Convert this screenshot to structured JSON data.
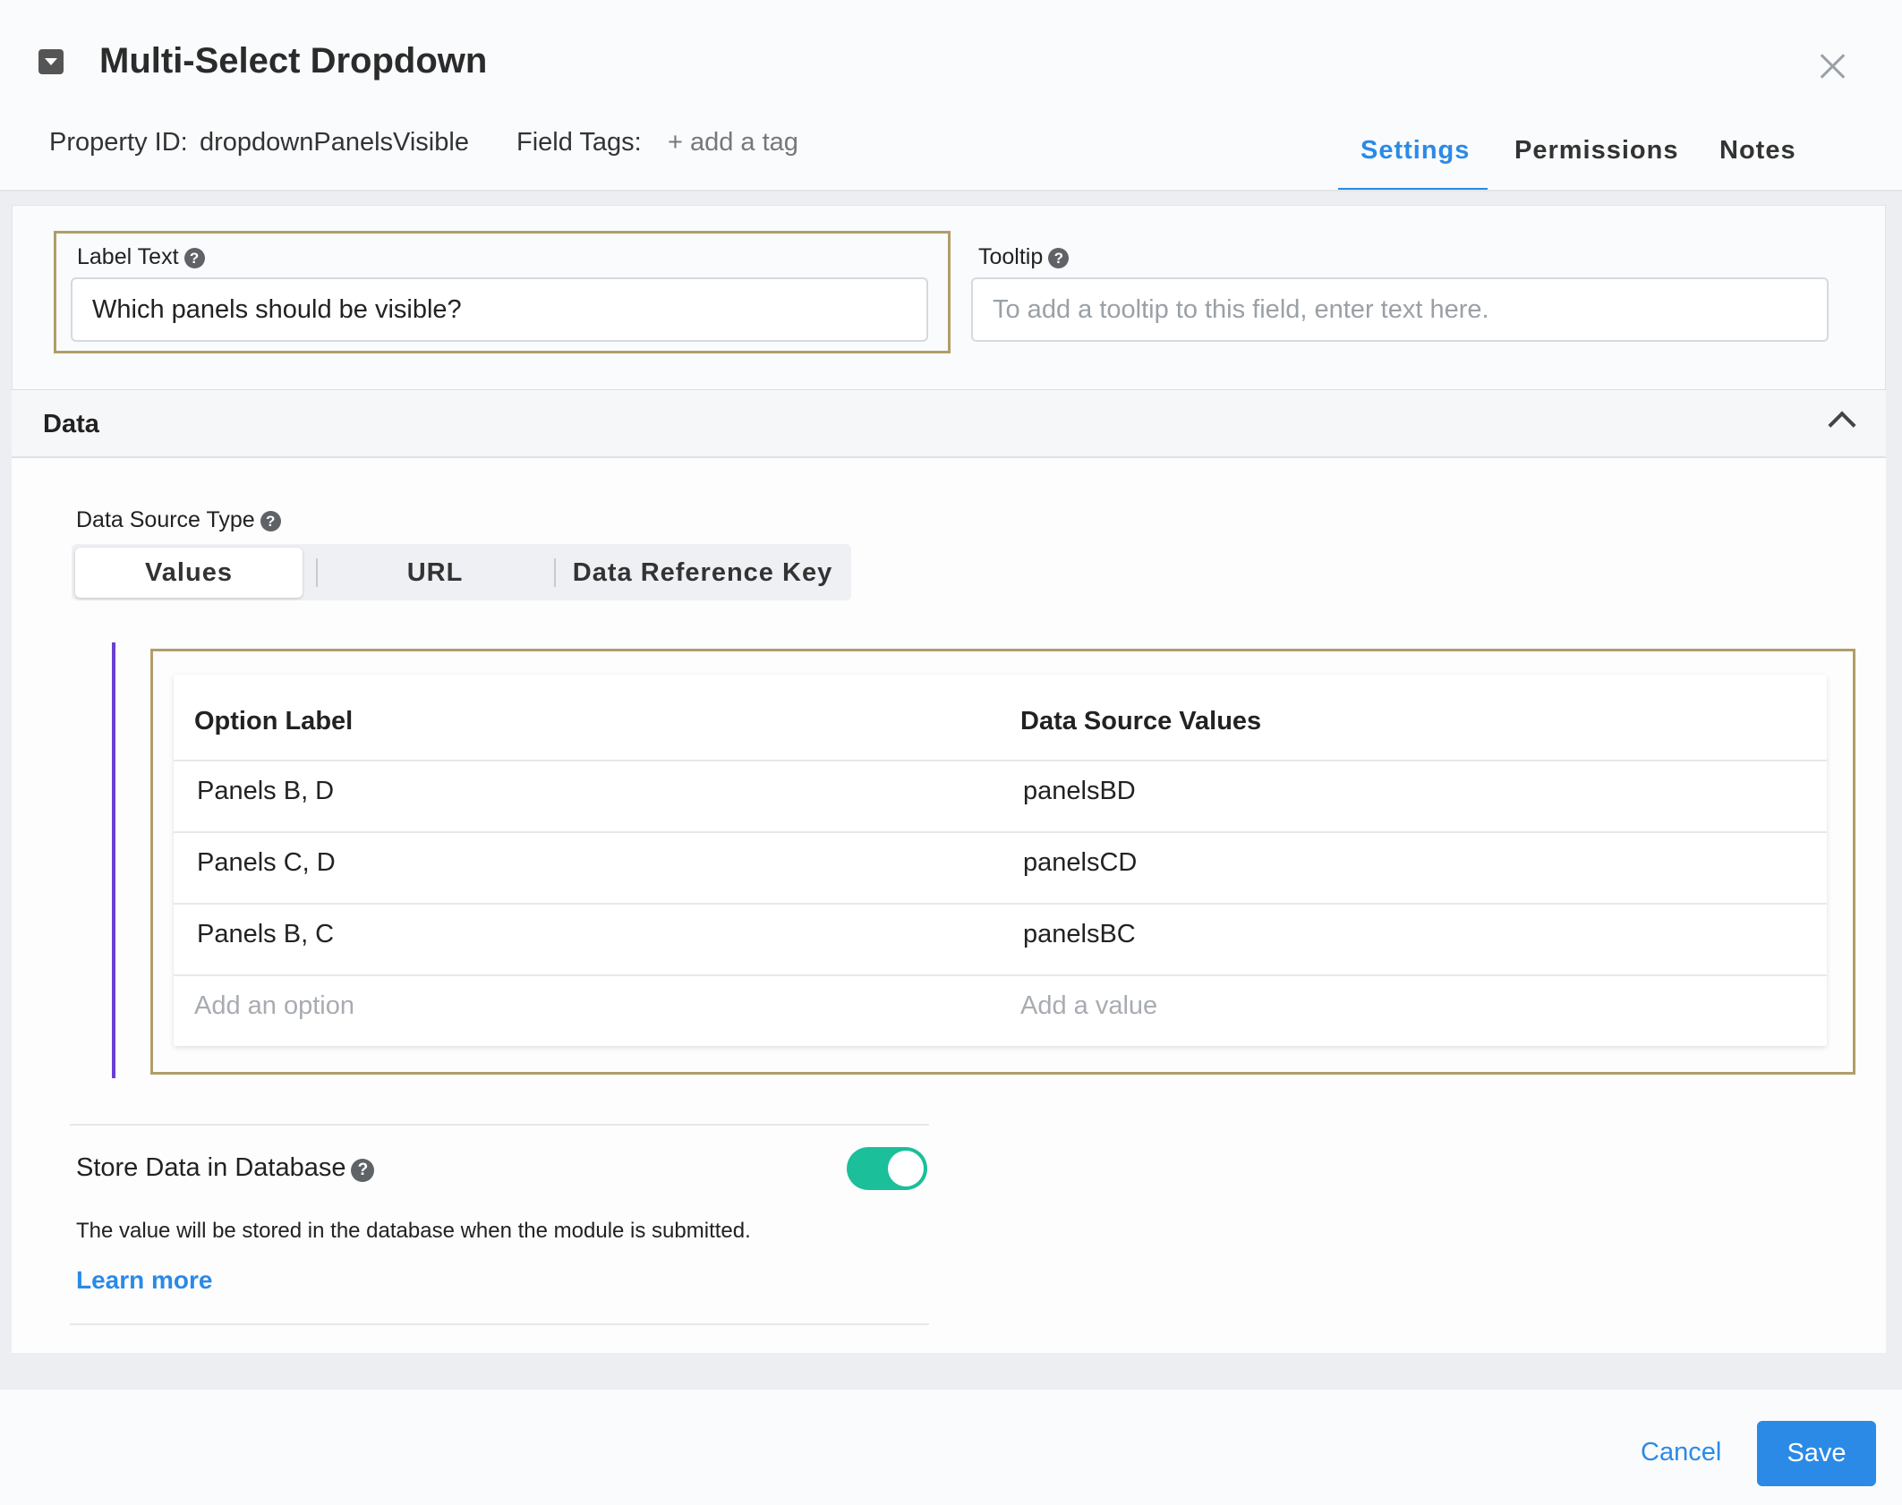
{
  "header": {
    "title": "Multi-Select Dropdown",
    "property_id_label": "Property ID:",
    "property_id_value": "dropdownPanelsVisible",
    "field_tags_label": "Field Tags:",
    "add_tag": "+ add a tag",
    "tabs": [
      {
        "label": "Settings",
        "active": true
      },
      {
        "label": "Permissions",
        "active": false
      },
      {
        "label": "Notes",
        "active": false
      }
    ]
  },
  "settings": {
    "label_text": {
      "label": "Label Text",
      "value": "Which panels should be visible?"
    },
    "tooltip": {
      "label": "Tooltip",
      "placeholder": "To add a tooltip to this field, enter text here."
    }
  },
  "data_section": {
    "title": "Data",
    "data_source_type_label": "Data Source Type",
    "segments": [
      {
        "label": "Values",
        "active": true
      },
      {
        "label": "URL",
        "active": false
      },
      {
        "label": "Data Reference Key",
        "active": false
      }
    ],
    "table": {
      "headers": [
        "Option Label",
        "Data Source Values"
      ],
      "rows": [
        [
          "Panels B, D",
          "panelsBD"
        ],
        [
          "Panels C, D",
          "panelsCD"
        ],
        [
          "Panels B, C",
          "panelsBC"
        ]
      ],
      "add_option_placeholder": "Add an option",
      "add_value_placeholder": "Add a value"
    },
    "store": {
      "label": "Store Data in Database",
      "enabled": true,
      "description": "The value will be stored in the database when the module is submitted.",
      "learn_more": "Learn more"
    }
  },
  "footer": {
    "cancel": "Cancel",
    "save": "Save"
  },
  "colors": {
    "accent": "#2b8ae6",
    "toggle_on": "#1bbf9a",
    "highlight_border": "#b09e6a",
    "purple_bar": "#6a3fd1"
  }
}
